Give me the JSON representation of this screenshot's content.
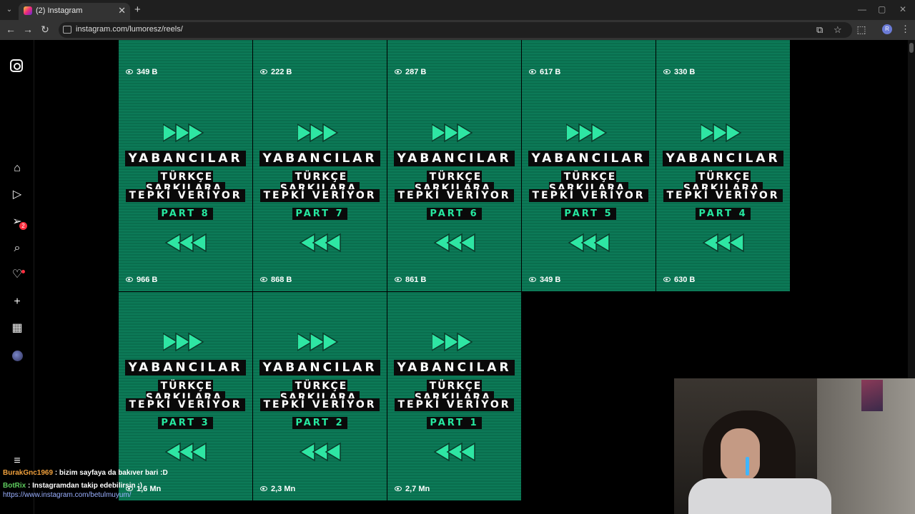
{
  "browser": {
    "tab_title": "(2) Instagram",
    "url": "instagram.com/lumoresz/reels/"
  },
  "reels_top": [
    {
      "views": "349 B"
    },
    {
      "views": "222 B"
    },
    {
      "views": "287 B"
    },
    {
      "views": "617 B"
    },
    {
      "views": "330 B"
    }
  ],
  "reels": [
    {
      "line1": "YABANCILAR",
      "line2": "TÜRKÇE ŞARKILARA",
      "line3": "TEPKİ VERİYOR",
      "part": "PART 8",
      "views": "966 B"
    },
    {
      "line1": "YABANCILAR",
      "line2": "TÜRKÇE ŞARKILARA",
      "line3": "TEPKİ VERİYOR",
      "part": "PART 7",
      "views": "868 B"
    },
    {
      "line1": "YABANCILAR",
      "line2": "TÜRKÇE ŞARKILARA",
      "line3": "TEPKİ VERİYOR",
      "part": "PART 6",
      "views": "861 B"
    },
    {
      "line1": "YABANCILAR",
      "line2": "TÜRKÇE ŞARKILARA",
      "line3": "TEPKİ VERİYOR",
      "part": "PART 5",
      "views": "349 B"
    },
    {
      "line1": "YABANCILAR",
      "line2": "TÜRKÇE ŞARKILARA",
      "line3": "TEPKİ VERİYOR",
      "part": "PART 4",
      "views": "630 B"
    },
    {
      "line1": "YABANCILAR",
      "line2": "TÜRKÇE ŞARKILARA",
      "line3": "TEPKİ VERİYOR",
      "part": "PART 3",
      "views": "1,6 Mn"
    },
    {
      "line1": "YABANCILAR",
      "line2": "TÜRKÇE ŞARKILARA",
      "line3": "TEPKİ VERİYOR",
      "part": "PART 2",
      "views": "2,3 Mn"
    },
    {
      "line1": "YABANCILAR",
      "line2": "TÜRKÇE ŞARKILARA",
      "line3": "TEPKİ VERİYOR",
      "part": "PART 1",
      "views": "2,7 Mn"
    }
  ],
  "sidebar": {
    "notifications_badge": "2"
  },
  "chat": [
    {
      "user": "BurakGnc1969",
      "message": " : bizim sayfaya da bakıver bari :D"
    },
    {
      "user": "BotRix",
      "message": " : Instagramdan takip edebilirsin :)"
    }
  ],
  "chat_link": "https://www.instagram.com/betulmuyum/",
  "colors": {
    "tile_green": "#0c7a57",
    "arrow_green": "#2ee6a3",
    "part_text": "#26e8a0",
    "badge_red": "#ff3040"
  }
}
